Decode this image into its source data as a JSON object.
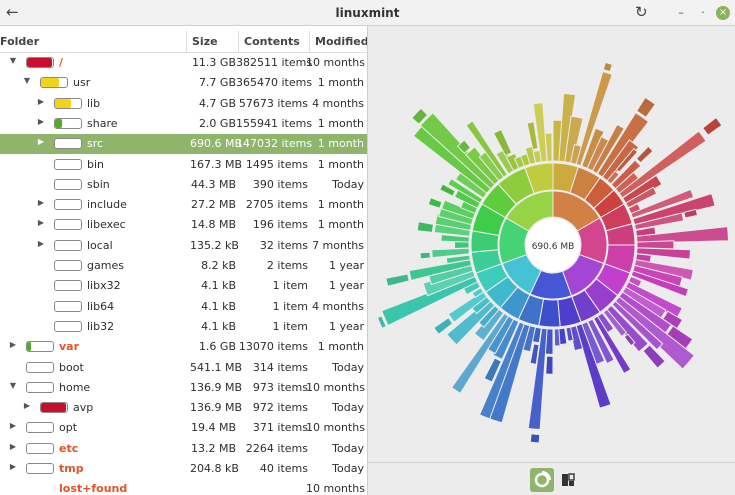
{
  "window": {
    "title": "linuxmint"
  },
  "columns": {
    "folder": "Folder",
    "size": "Size",
    "contents": "Contents",
    "modified": "Modified"
  },
  "rows": [
    {
      "name": "/",
      "size": "11.3 GB",
      "contents": "382511 items",
      "modified": "10 months",
      "fill": 0.95,
      "color": "#c8102e",
      "red": true
    },
    {
      "name": "usr",
      "size": "7.7 GB",
      "contents": "365470 items",
      "modified": "1 month",
      "fill": 0.68,
      "color": "#f2d21b"
    },
    {
      "name": "lib",
      "size": "4.7 GB",
      "contents": "57673 items",
      "modified": "4 months",
      "fill": 0.61,
      "color": "#f2d21b"
    },
    {
      "name": "share",
      "size": "2.0 GB",
      "contents": "155941 items",
      "modified": "1 month",
      "fill": 0.26,
      "color": "#4caf1e"
    },
    {
      "name": "src",
      "size": "690.6 MB",
      "contents": "147032 items",
      "modified": "1 month",
      "fill": 0.0,
      "color": "#ffffff"
    },
    {
      "name": "bin",
      "size": "167.3 MB",
      "contents": "1495 items",
      "modified": "1 month",
      "fill": 0.0,
      "color": "#ffffff"
    },
    {
      "name": "sbin",
      "size": "44.3 MB",
      "contents": "390 items",
      "modified": "Today",
      "fill": 0.0,
      "color": "#ffffff"
    },
    {
      "name": "include",
      "size": "27.2 MB",
      "contents": "2705 items",
      "modified": "1 month",
      "fill": 0.0,
      "color": "#ffffff"
    },
    {
      "name": "libexec",
      "size": "14.8 MB",
      "contents": "196 items",
      "modified": "1 month",
      "fill": 0.0,
      "color": "#ffffff"
    },
    {
      "name": "local",
      "size": "135.2 kB",
      "contents": "32 items",
      "modified": "7 months",
      "fill": 0.0,
      "color": "#ffffff"
    },
    {
      "name": "games",
      "size": "8.2 kB",
      "contents": "2 items",
      "modified": "1 year",
      "fill": 0.0,
      "color": "#ffffff"
    },
    {
      "name": "libx32",
      "size": "4.1 kB",
      "contents": "1 item",
      "modified": "1 year",
      "fill": 0.0,
      "color": "#ffffff"
    },
    {
      "name": "lib64",
      "size": "4.1 kB",
      "contents": "1 item",
      "modified": "4 months",
      "fill": 0.0,
      "color": "#ffffff"
    },
    {
      "name": "lib32",
      "size": "4.1 kB",
      "contents": "1 item",
      "modified": "1 year",
      "fill": 0.0,
      "color": "#ffffff"
    },
    {
      "name": "var",
      "size": "1.6 GB",
      "contents": "13070 items",
      "modified": "1 month",
      "fill": 0.14,
      "color": "#4caf1e",
      "red": true
    },
    {
      "name": "boot",
      "size": "541.1 MB",
      "contents": "314 items",
      "modified": "Today",
      "fill": 0.0,
      "color": "#ffffff"
    },
    {
      "name": "home",
      "size": "136.9 MB",
      "contents": "973 items",
      "modified": "10 months",
      "fill": 0.0,
      "color": "#ffffff"
    },
    {
      "name": "avp",
      "size": "136.9 MB",
      "contents": "972 items",
      "modified": "Today",
      "fill": 0.95,
      "color": "#c8102e"
    },
    {
      "name": "opt",
      "size": "19.4 MB",
      "contents": "371 items",
      "modified": "10 months",
      "fill": 0.0,
      "color": "#ffffff"
    },
    {
      "name": "etc",
      "size": "13.2 MB",
      "contents": "2264 items",
      "modified": "Today",
      "fill": 0.0,
      "color": "#ffffff",
      "red": true
    },
    {
      "name": "tmp",
      "size": "204.8 kB",
      "contents": "40 items",
      "modified": "Today",
      "fill": 0.0,
      "color": "#ffffff",
      "red": true
    },
    {
      "name": "lost+found",
      "size": "",
      "contents": "",
      "modified": "10 months",
      "fill": 0.0,
      "color": "#ffffff",
      "red": true,
      "nobar": true
    }
  ],
  "chart": {
    "center_label": "690.6 MB"
  }
}
